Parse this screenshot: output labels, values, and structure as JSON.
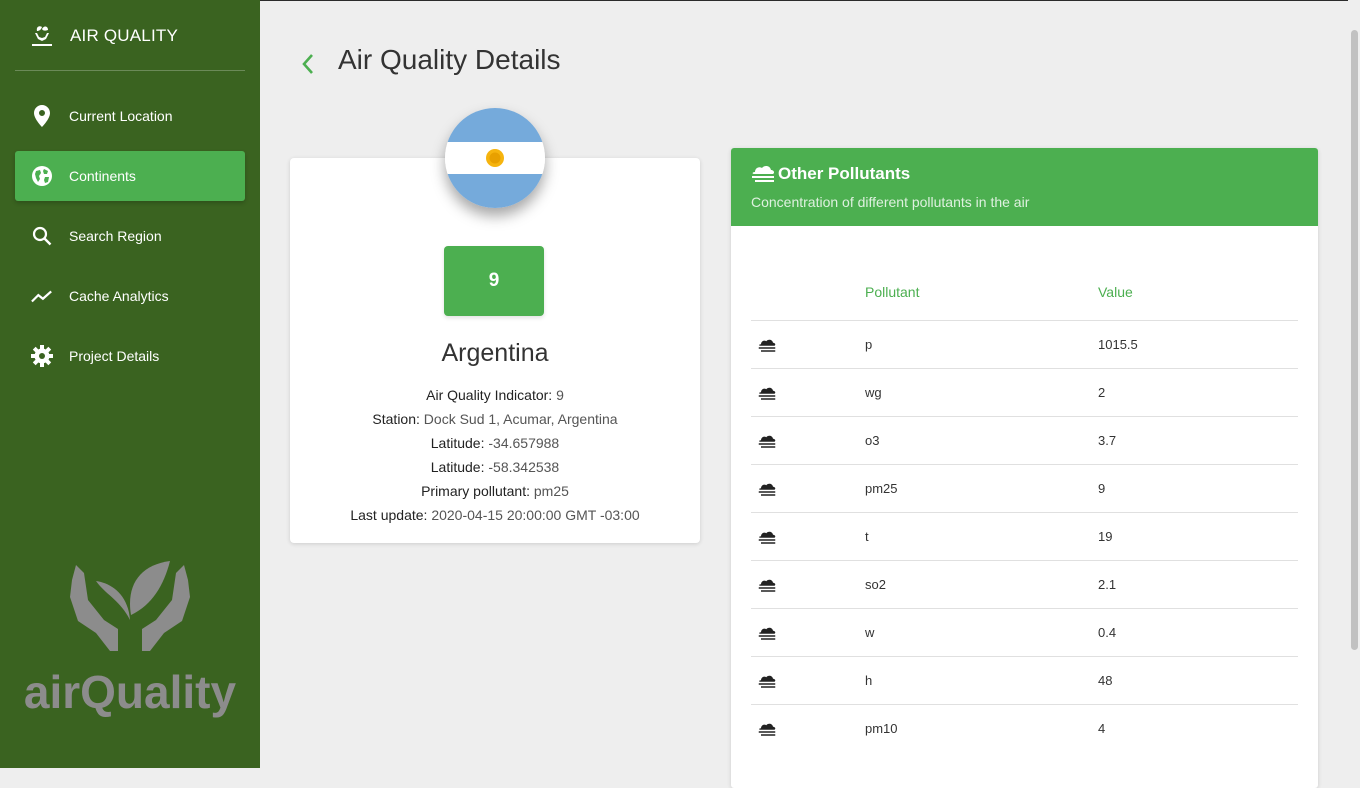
{
  "app": {
    "title": "AIR QUALITY",
    "logo_text": "airQuality"
  },
  "sidebar": {
    "items": [
      {
        "label": "Current Location",
        "icon": "location-pin-icon"
      },
      {
        "label": "Continents",
        "icon": "globe-icon",
        "active": true
      },
      {
        "label": "Search Region",
        "icon": "search-icon"
      },
      {
        "label": "Cache Analytics",
        "icon": "trending-up-icon"
      },
      {
        "label": "Project Details",
        "icon": "gear-icon"
      }
    ],
    "watermark_text": "airQuality"
  },
  "page": {
    "title": "Air Quality Details"
  },
  "country_card": {
    "flag": "argentina-flag",
    "aqi": "9",
    "country": "Argentina",
    "fields": [
      {
        "key": "Air Quality Indicator:",
        "value": "9"
      },
      {
        "key": "Station:",
        "value": "Dock Sud 1, Acumar, Argentina"
      },
      {
        "key": "Latitude:",
        "value": "-34.657988"
      },
      {
        "key": "Latitude:",
        "value": "-58.342538"
      },
      {
        "key": "Primary pollutant:",
        "value": "pm25"
      },
      {
        "key": "Last update:",
        "value": "2020-04-15 20:00:00 GMT -03:00"
      }
    ]
  },
  "pollutants": {
    "title": "Other Pollutants",
    "subtitle": "Concentration of different pollutants in the air",
    "columns": {
      "pollutant": "Pollutant",
      "value": "Value"
    },
    "rows": [
      {
        "name": "p",
        "value": "1015.5"
      },
      {
        "name": "wg",
        "value": "2"
      },
      {
        "name": "o3",
        "value": "3.7"
      },
      {
        "name": "pm25",
        "value": "9"
      },
      {
        "name": "t",
        "value": "19"
      },
      {
        "name": "so2",
        "value": "2.1"
      },
      {
        "name": "w",
        "value": "0.4"
      },
      {
        "name": "h",
        "value": "48"
      },
      {
        "name": "pm10",
        "value": "4"
      }
    ]
  },
  "colors": {
    "sidebar": "#3a6320",
    "accent": "#4caf50",
    "background": "#eeeeee"
  }
}
